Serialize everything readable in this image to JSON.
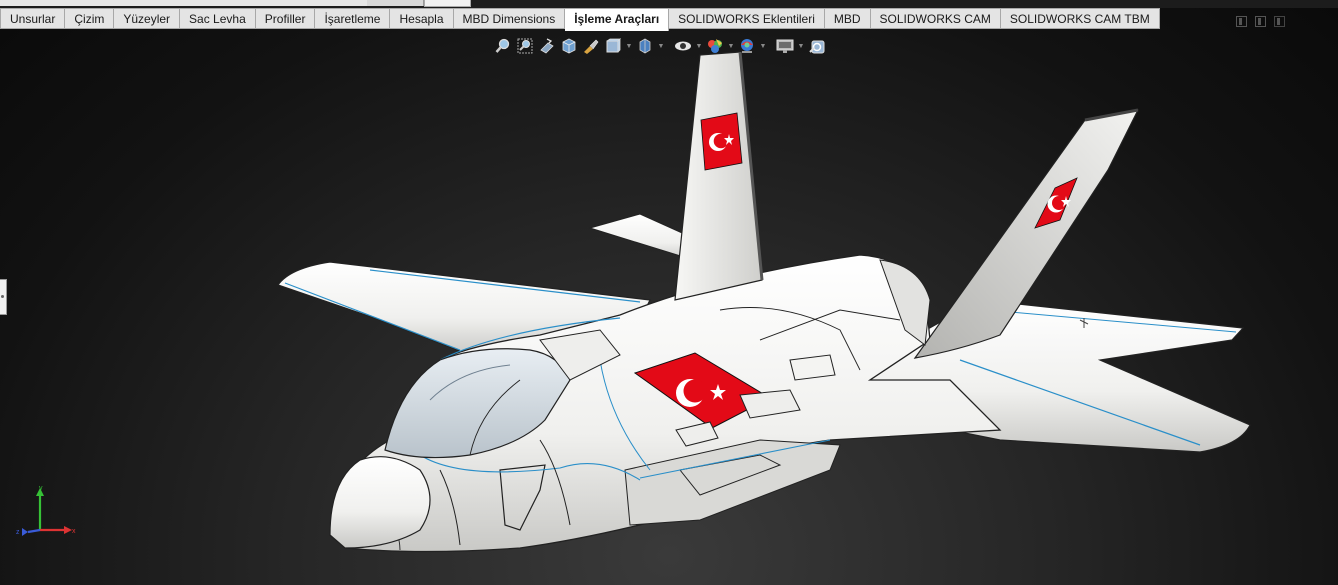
{
  "tabs": [
    {
      "label": "Unsurlar",
      "active": false
    },
    {
      "label": "Çizim",
      "active": false
    },
    {
      "label": "Yüzeyler",
      "active": false
    },
    {
      "label": "Sac Levha",
      "active": false
    },
    {
      "label": "Profiller",
      "active": false
    },
    {
      "label": "İşaretleme",
      "active": false
    },
    {
      "label": "Hesapla",
      "active": false
    },
    {
      "label": "MBD Dimensions",
      "active": false
    },
    {
      "label": "İşleme Araçları",
      "active": true
    },
    {
      "label": "SOLIDWORKS Eklentileri",
      "active": false
    },
    {
      "label": "MBD",
      "active": false
    },
    {
      "label": "SOLIDWORKS CAM",
      "active": false
    },
    {
      "label": "SOLIDWORKS CAM TBM",
      "active": false
    }
  ],
  "heads_up_toolbar": [
    "zoom-to-fit-icon",
    "zoom-to-area-icon",
    "previous-view-icon",
    "section-view-icon",
    "dynamic-annotation-icon",
    "view-orientation-icon",
    "display-style-icon",
    "hide-show-items-icon",
    "edit-appearance-icon",
    "apply-scene-icon",
    "view-settings-icon",
    "rotate-view-icon"
  ],
  "colors": {
    "viewport_bg": "#1a1a1a",
    "model_white": "#f4f4f2",
    "flag_red": "#e30a17",
    "edge_blue": "#2a8fc9",
    "tab_active": "#ffffff",
    "tab_bg": "#e4e4e4"
  },
  "triad": {
    "x_label": "x",
    "y_label": "y",
    "z_label": "z"
  }
}
